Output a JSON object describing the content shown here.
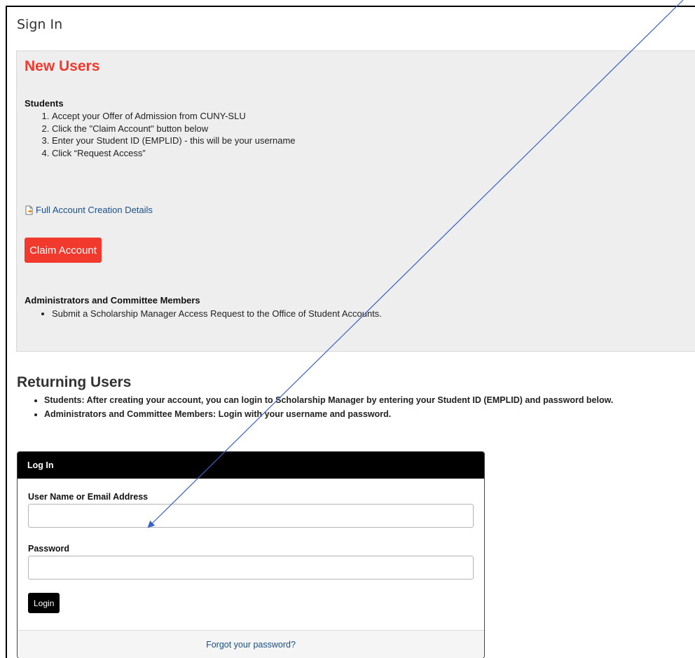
{
  "page": {
    "title": "Sign In"
  },
  "new_users": {
    "heading": "New Users",
    "students_heading": "Students",
    "student_steps": [
      "Accept your Offer of Admission from CUNY-SLU",
      "Click the \"Claim Account\" button below",
      "Enter your Student ID (EMPLID) - this will be your username",
      "Click “Request Access”"
    ],
    "details_link": "Full Account Creation Details",
    "details_icon": "document-arrow-icon",
    "claim_button": "Claim Account",
    "admins_heading": "Administrators and Committee Members",
    "admin_steps": [
      "Submit a Scholarship Manager Access Request to the Office of Student Accounts."
    ]
  },
  "returning_users": {
    "heading": "Returning Users",
    "items": [
      "Students: After creating your account, you can login to Scholarship Manager by entering your Student ID (EMPLID) and password below.",
      "Administrators and Committee Members: Login with your username and password."
    ]
  },
  "login": {
    "header": "Log In",
    "username_label": "User Name or Email Address",
    "username_value": "",
    "password_label": "Password",
    "password_value": "",
    "login_button": "Login",
    "forgot_link": "Forgot your password?"
  },
  "colors": {
    "accent_red": "#f2392d",
    "panel_gray": "#eeeeee",
    "link_blue": "#1a4f8a",
    "annotation_arrow": "#3a5fc8"
  }
}
